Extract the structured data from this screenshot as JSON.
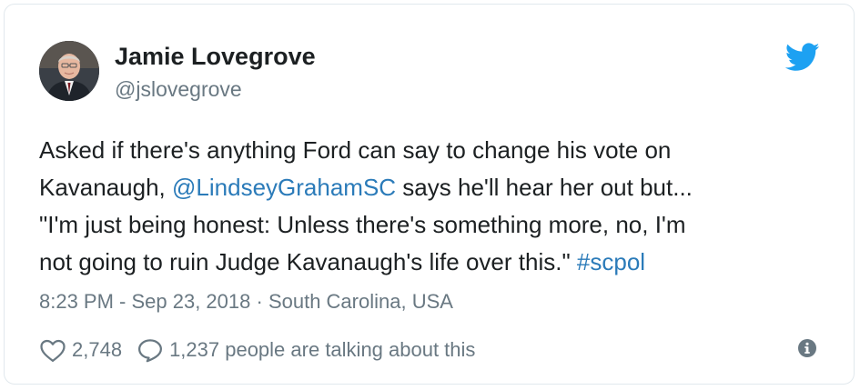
{
  "tweet": {
    "author": {
      "name": "Jamie Lovegrove",
      "handle": "@jslovegrove"
    },
    "body": {
      "line1": "Asked if there's anything Ford can say to change his vote on",
      "line2_pre": "Kavanaugh, ",
      "mention": "@LindseyGrahamSC",
      "line2_post": " says he'll hear her out but...",
      "line3": "\"I'm just being honest: Unless there's something more, no, I'm",
      "line4_pre": "not going to ruin Judge Kavanaugh's life over this.\" ",
      "hashtag": "#scpol"
    },
    "meta": {
      "time": "8:23 PM - Sep 23, 2018",
      "separator": " · ",
      "location": "South Carolina, USA"
    },
    "actions": {
      "likes": "2,748",
      "talking": "1,237 people are talking about this"
    }
  },
  "colors": {
    "brand": "#1da1f2",
    "link": "#2b7bb9",
    "text": "#1c2022",
    "muted": "#697882",
    "border": "#e1e8ed"
  },
  "icons": {
    "brand": "twitter-bird-icon",
    "like": "heart-icon",
    "reply": "comment-bubble-icon",
    "info": "info-icon"
  }
}
